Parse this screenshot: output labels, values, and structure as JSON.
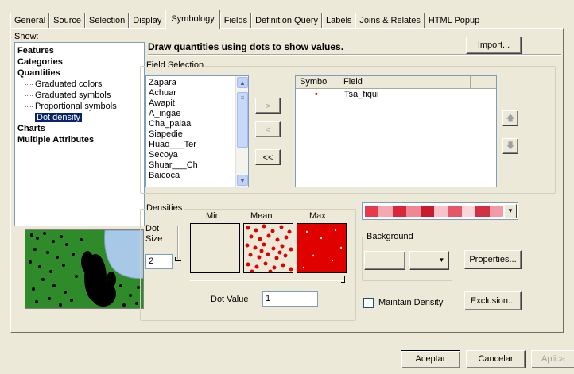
{
  "tabs": [
    {
      "label": "General"
    },
    {
      "label": "Source"
    },
    {
      "label": "Selection"
    },
    {
      "label": "Display"
    },
    {
      "label": "Symbology"
    },
    {
      "label": "Fields"
    },
    {
      "label": "Definition Query"
    },
    {
      "label": "Labels"
    },
    {
      "label": "Joins & Relates"
    },
    {
      "label": "HTML Popup"
    }
  ],
  "active_tab": "Symbology",
  "show": {
    "label": "Show:",
    "items": [
      {
        "label": "Features",
        "bold": true
      },
      {
        "label": "Categories",
        "bold": true
      },
      {
        "label": "Quantities",
        "bold": true
      },
      {
        "label": "Graduated colors",
        "bold": false
      },
      {
        "label": "Graduated symbols",
        "bold": false
      },
      {
        "label": "Proportional symbols",
        "bold": false
      },
      {
        "label": "Dot density",
        "bold": false,
        "selected": true
      },
      {
        "label": "Charts",
        "bold": true
      },
      {
        "label": "Multiple Attributes",
        "bold": true
      }
    ]
  },
  "description": "Draw quantities using dots to show values.",
  "import_label": "Import...",
  "field_selection": {
    "title": "Field Selection",
    "fields": [
      "Zapara",
      "Achuar",
      "Awapit",
      "A_ingae",
      "Cha_palaa",
      "Siapedie",
      "Huao___Ter",
      "Secoya",
      "Shuar___Ch",
      "Baicoca"
    ],
    "btn_add": ">",
    "btn_remove": "<",
    "btn_remove_all": "<<",
    "table_headers": {
      "symbol": "Symbol",
      "field": "Field"
    },
    "rows": [
      {
        "symbol": "•",
        "field": "Tsa_fiqui"
      }
    ],
    "symbol_color": "#e00000"
  },
  "densities": {
    "title": "Densities",
    "min": "Min",
    "mean": "Mean",
    "max": "Max",
    "dot_size_label": "Dot\nSize",
    "dot_size_value": "2",
    "dot_value_label": "Dot Value",
    "dot_value": "1",
    "slider_level": 1.0
  },
  "background": {
    "title": "Background",
    "properties_label": "Properties..."
  },
  "maintain_density": {
    "label": "Maintain Density",
    "checked": false
  },
  "exclusion_label": "Exclusion...",
  "color_ramp": [
    "#e8394b",
    "#f4a8b3",
    "#d9273a",
    "#f08795",
    "#c61c2e",
    "#f7c2ca",
    "#e5566a",
    "#fbd6db",
    "#d23045",
    "#f39aa8"
  ],
  "footer": {
    "ok": "Aceptar",
    "cancel": "Cancelar",
    "apply": "Aplica"
  }
}
